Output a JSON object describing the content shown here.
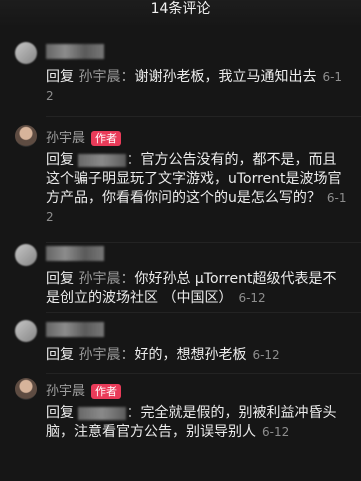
{
  "header": {
    "title": "14条评论"
  },
  "comments": [
    {
      "reply_word": "回复",
      "target": "孙宇晨",
      "text": "谢谢孙老板，我立马通知出去",
      "date": "6-12"
    },
    {
      "username": "孙宇晨",
      "badge": "作者",
      "reply_word": "回复",
      "text": "官方公告没有的，都不是，而且这个骗子明显玩了文字游戏，uTorrent是波场官方产品，你看看你问的这个的u是怎么写的？",
      "date": "6-12"
    },
    {
      "reply_word": "回复",
      "target": "孙宇晨",
      "text": "你好孙总 µTorrent超级代表是不是创立的波场社区 （中国区）",
      "date": "6-12"
    },
    {
      "reply_word": "回复",
      "target": "孙宇晨",
      "text": "好的，想想孙老板",
      "date": "6-12"
    },
    {
      "username": "孙宇晨",
      "badge": "作者",
      "reply_word": "回复",
      "text": "完全就是假的，别被利益冲昏头脑，注意看官方公告，别误导别人",
      "date": "6-12"
    }
  ]
}
